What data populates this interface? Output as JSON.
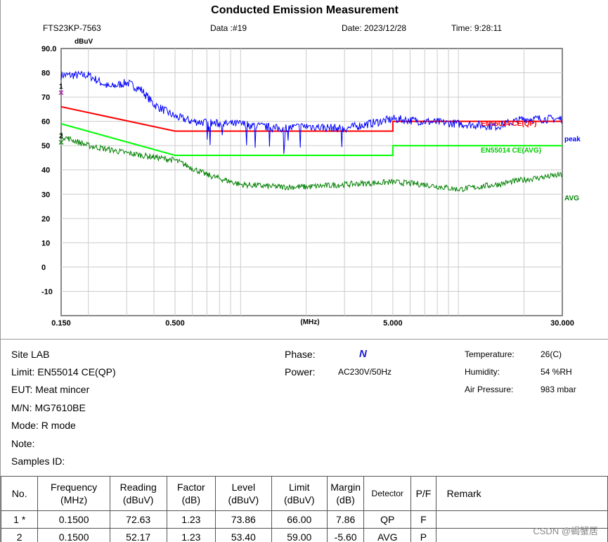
{
  "header": {
    "title": "Conducted Emission Measurement",
    "report_id": "FTS23KP-7563",
    "data": "Data :#19",
    "date": "Date: 2023/12/28",
    "time": "Time: 9:28:11"
  },
  "chart_data": {
    "type": "line",
    "ylabel": "dBuV",
    "xlabel": "(MHz)",
    "xscale": "log",
    "xlim": [
      0.15,
      30
    ],
    "ylim": [
      -20,
      90
    ],
    "y_ticks": [
      "90.0",
      "80",
      "70",
      "60",
      "50",
      "40",
      "30",
      "20",
      "10",
      "0",
      "-10"
    ],
    "x_ticks": [
      {
        "v": 0.15,
        "label": "0.150"
      },
      {
        "v": 0.5,
        "label": "0.500"
      },
      {
        "v": 5,
        "label": "5.000"
      },
      {
        "v": 30,
        "label": "30.000"
      }
    ],
    "grid": true,
    "series": [
      {
        "name": "EN55014 CE(QP)",
        "color": "#ff0000",
        "points": [
          [
            0.15,
            66
          ],
          [
            0.5,
            56
          ],
          [
            5,
            56
          ],
          [
            5,
            60
          ],
          [
            30,
            60
          ]
        ]
      },
      {
        "name": "EN55014 CE(AVG)",
        "color": "#00ff00",
        "points": [
          [
            0.15,
            59
          ],
          [
            0.5,
            46
          ],
          [
            5,
            46
          ],
          [
            5,
            50
          ],
          [
            30,
            50
          ]
        ]
      },
      {
        "name": "peak",
        "color": "#0000ff",
        "points": [
          [
            0.15,
            79
          ],
          [
            0.2,
            79
          ],
          [
            0.25,
            74
          ],
          [
            0.3,
            76
          ],
          [
            0.35,
            73
          ],
          [
            0.4,
            67
          ],
          [
            0.5,
            62
          ],
          [
            0.6,
            60
          ],
          [
            0.8,
            59
          ],
          [
            1,
            59
          ],
          [
            1.5,
            57
          ],
          [
            2,
            58
          ],
          [
            3,
            57
          ],
          [
            5,
            61
          ],
          [
            7,
            60
          ],
          [
            10,
            59
          ],
          [
            15,
            58
          ],
          [
            20,
            61
          ],
          [
            30,
            61
          ]
        ]
      },
      {
        "name": "AVG",
        "color": "#008000",
        "points": [
          [
            0.15,
            54
          ],
          [
            0.2,
            50
          ],
          [
            0.3,
            47
          ],
          [
            0.5,
            44
          ],
          [
            0.7,
            38
          ],
          [
            1,
            34
          ],
          [
            1.5,
            33
          ],
          [
            2,
            33
          ],
          [
            3,
            34
          ],
          [
            5,
            35
          ],
          [
            7,
            34
          ],
          [
            10,
            32
          ],
          [
            15,
            34
          ],
          [
            20,
            36
          ],
          [
            30,
            38
          ]
        ]
      }
    ],
    "markers": [
      {
        "label": "1",
        "x": 0.15,
        "y": 73.86
      },
      {
        "label": "2",
        "x": 0.15,
        "y": 53.4
      }
    ]
  },
  "info": {
    "site": "Site  LAB",
    "limit": "Limit:  EN55014 CE(QP)",
    "eut": "EUT:  Meat mincer",
    "mn": "M/N:   MG7610BE",
    "mode": "Mode:   R mode",
    "note": "Note:",
    "samples": "Samples ID:",
    "phase_label": "Phase:",
    "phase_value": "N",
    "power_label": "Power:",
    "power_value": "AC230V/50Hz",
    "temp_label": "Temperature:",
    "temp_value": "26(C)",
    "hum_label": "Humidity:",
    "hum_value": "54 %RH",
    "press_label": "Air Pressure:",
    "press_value": "983 mbar"
  },
  "table": {
    "headers": [
      "No.",
      "Frequency\n(MHz)",
      "Reading\n(dBuV)",
      "Factor\n(dB)",
      "Level\n(dBuV)",
      "Limit\n(dBuV)",
      "Margin\n(dB)",
      "Detector",
      "P/F",
      "Remark"
    ],
    "rows": [
      [
        "1  *",
        "0.1500",
        "72.63",
        "1.23",
        "73.86",
        "66.00",
        "7.86",
        "QP",
        "F",
        ""
      ],
      [
        "2",
        "0.1500",
        "52.17",
        "1.23",
        "53.40",
        "59.00",
        "-5.60",
        "AVG",
        "P",
        ""
      ]
    ]
  },
  "watermark": "CSDN @蝎蟹居"
}
